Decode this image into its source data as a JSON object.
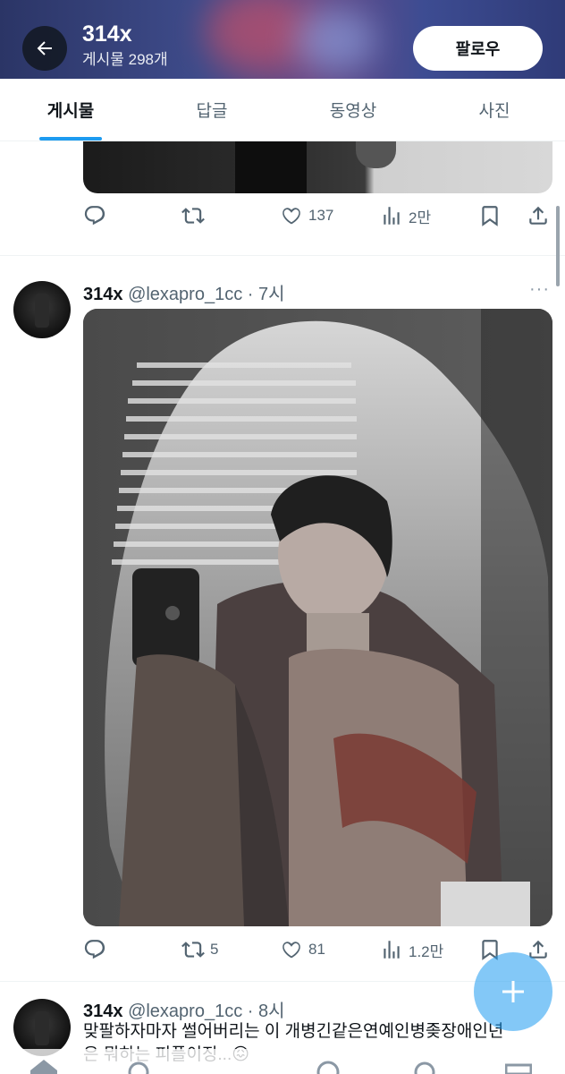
{
  "header": {
    "title": "314x",
    "subtitle": "게시물 298개",
    "follow_label": "팔로우"
  },
  "tabs": [
    {
      "label": "게시물",
      "active": true
    },
    {
      "label": "답글",
      "active": false
    },
    {
      "label": "동영상",
      "active": false
    },
    {
      "label": "사진",
      "active": false
    }
  ],
  "tweet1": {
    "reply_count": "",
    "retweet_count": "",
    "like_count": "137",
    "view_count": "2만"
  },
  "tweet2": {
    "name": "314x",
    "handle": "@lexapro_1cc",
    "time": "· 7시",
    "more": "···",
    "reply_count": "",
    "retweet_count": "5",
    "like_count": "81",
    "view_count": "1.2만"
  },
  "tweet3": {
    "name": "314x",
    "handle": "@lexapro_1cc",
    "time": "· 8시",
    "text_line1": "맞팔하자마자 썰어버리는 이 개병긴같은연예인병좆장애인년",
    "text_line2": "은 뭐하는 피플이징...😖"
  },
  "colors": {
    "accent": "#1d9bf0",
    "text_secondary": "#536471",
    "header_bg": "#3e4b8a"
  },
  "icons": [
    "back-arrow-icon",
    "reply-icon",
    "retweet-icon",
    "like-icon",
    "views-icon",
    "bookmark-icon",
    "share-icon",
    "plus-icon",
    "more-icon"
  ]
}
